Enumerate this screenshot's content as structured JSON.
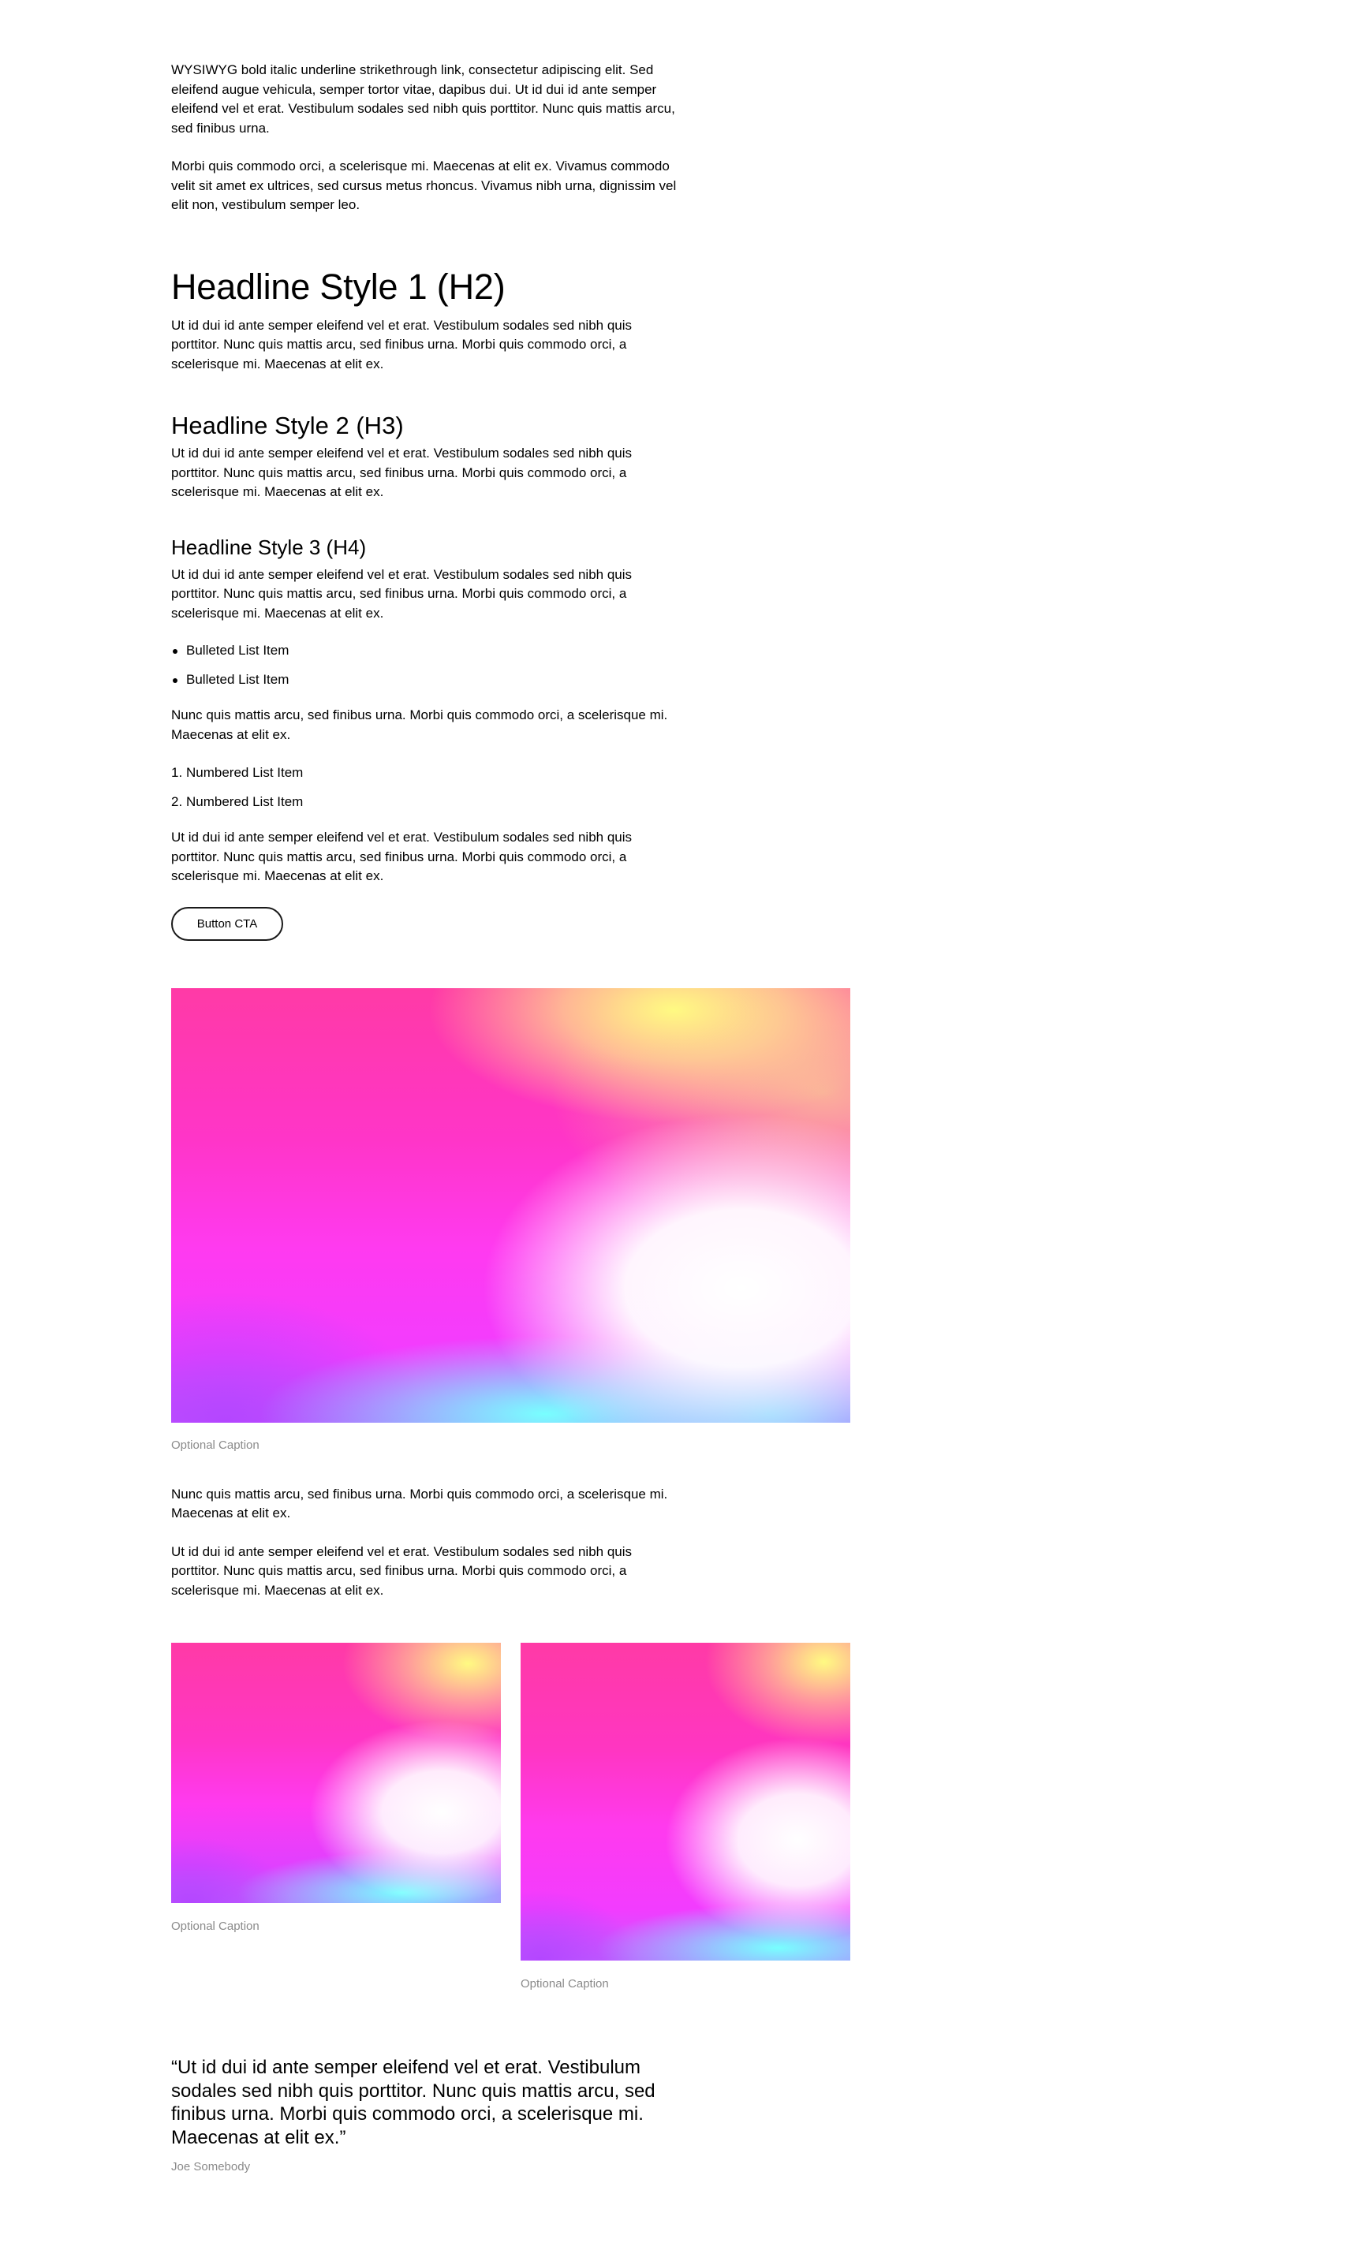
{
  "intro": {
    "paragraph1": "WYSIWYG bold italic underline strikethrough link, consectetur adipiscing elit. Sed eleifend augue vehicula, semper tortor vitae, dapibus dui. Ut id dui id ante semper eleifend vel et erat. Vestibulum sodales sed nibh quis porttitor. Nunc quis mattis arcu, sed finibus urna.",
    "paragraph2": "Morbi quis commodo orci, a scelerisque mi. Maecenas at elit ex. Vivamus commodo velit sit amet ex ultrices, sed cursus metus rhoncus. Vivamus nibh urna, dignissim vel elit non, vestibulum semper leo."
  },
  "h2": {
    "heading": "Headline Style 1 (H2)",
    "body": "Ut id dui id ante semper eleifend vel et erat. Vestibulum sodales sed nibh quis porttitor. Nunc quis mattis arcu, sed finibus urna. Morbi quis commodo orci, a scelerisque mi. Maecenas at elit ex."
  },
  "h3": {
    "heading": "Headline Style 2 (H3)",
    "body": "Ut id dui id ante semper eleifend vel et erat. Vestibulum sodales sed nibh quis porttitor. Nunc quis mattis arcu, sed finibus urna. Morbi quis commodo orci, a scelerisque mi. Maecenas at elit ex."
  },
  "h4": {
    "heading": "Headline Style 3 (H4)",
    "body": "Ut id dui id ante semper eleifend vel et erat. Vestibulum sodales sed nibh quis porttitor. Nunc quis mattis arcu, sed finibus urna. Morbi quis commodo orci, a scelerisque mi. Maecenas at elit ex."
  },
  "bullets": [
    "Bulleted List Item",
    "Bulleted List Item"
  ],
  "after_bullets": "Nunc quis mattis arcu, sed finibus urna. Morbi quis commodo orci, a scelerisque mi. Maecenas at elit ex.",
  "numbered": [
    {
      "num": "1.",
      "label": "Numbered List Item"
    },
    {
      "num": "2.",
      "label": "Numbered List Item"
    }
  ],
  "after_numbered": "Ut id dui id ante semper eleifend vel et erat. Vestibulum sodales sed nibh quis porttitor. Nunc quis mattis arcu, sed finibus urna. Morbi quis commodo orci, a scelerisque mi. Maecenas at elit ex.",
  "cta": {
    "label": "Button CTA"
  },
  "figure_wide": {
    "caption": "Optional Caption"
  },
  "after_figure": {
    "paragraph1": "Nunc quis mattis arcu, sed finibus urna. Morbi quis commodo orci, a scelerisque mi. Maecenas at elit ex.",
    "paragraph2": "Ut id dui id ante semper eleifend vel et erat. Vestibulum sodales sed nibh quis porttitor. Nunc quis mattis arcu, sed finibus urna. Morbi quis commodo orci, a scelerisque mi. Maecenas at elit ex."
  },
  "figure_pair": [
    {
      "caption": "Optional Caption"
    },
    {
      "caption": "Optional Caption"
    }
  ],
  "quote": {
    "text": "“Ut id dui id ante semper eleifend vel et erat. Vestibulum sodales sed nibh quis porttitor. Nunc quis mattis arcu, sed finibus urna. Morbi quis commodo orci, a scelerisque mi. Maecenas at elit ex.”",
    "author": "Joe Somebody"
  },
  "colors": {
    "text": "#000000",
    "caption": "#8a8a8a",
    "button_border": "#1a1a1a",
    "background": "#ffffff"
  }
}
